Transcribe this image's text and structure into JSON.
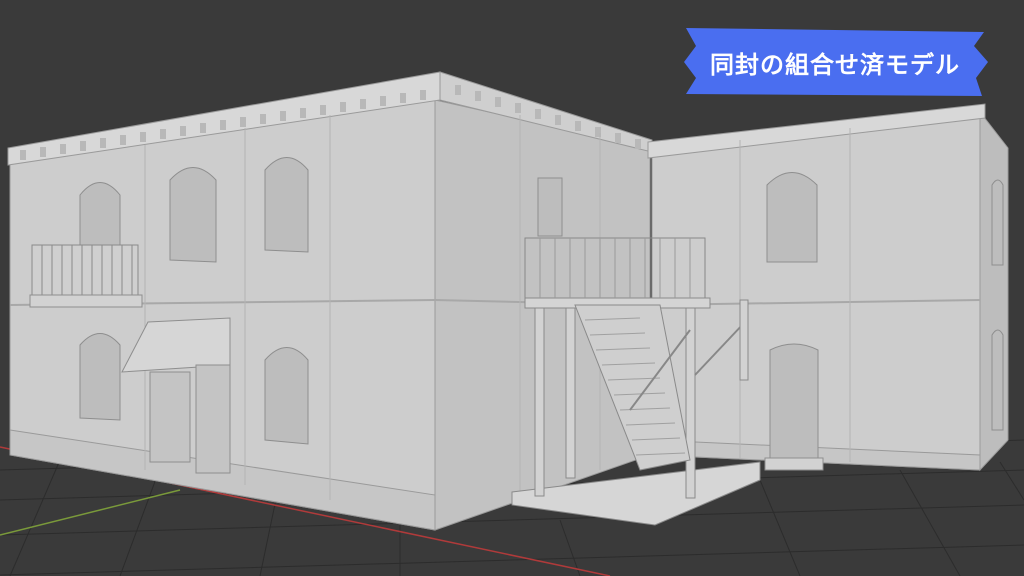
{
  "banner": {
    "text": "同封の組合せ済モデル",
    "color": "#4a6ef0"
  },
  "scene": {
    "background_color": "#3a3a3a",
    "model_color": "#c9c9c9",
    "axis_x_color": "#b03a3a",
    "axis_y_color": "#7a9a3a"
  }
}
